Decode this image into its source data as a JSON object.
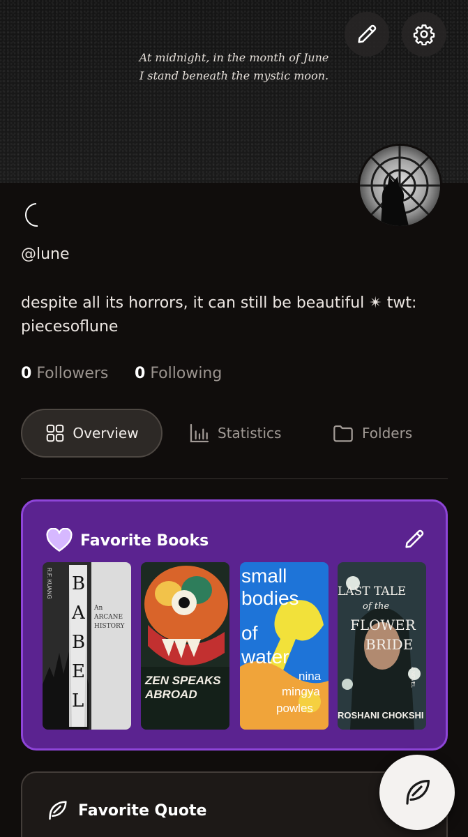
{
  "banner": {
    "quote_line1": "At midnight, in the month of June",
    "quote_line2": "I stand beneath the mystic moon."
  },
  "profile": {
    "display_name_icon": "crescent-moon-icon",
    "handle": "@lune",
    "bio": "despite all its horrors, it can still be beautiful ✴ twt: piecesoflune",
    "followers_count": "0",
    "followers_label": "Followers",
    "following_count": "0",
    "following_label": "Following"
  },
  "tabs": [
    {
      "label": "Overview",
      "icon": "grid-icon",
      "active": true
    },
    {
      "label": "Statistics",
      "icon": "bar-chart-icon",
      "active": false
    },
    {
      "label": "Folders",
      "icon": "folder-icon",
      "active": false
    }
  ],
  "favorite_books": {
    "title": "Favorite Books",
    "books": [
      {
        "cover_text": "BABEL",
        "author": "R.F. KUANG",
        "subtitle": "An ARCANE HISTORY"
      },
      {
        "cover_text": "ZEN SPEAKS ABROAD"
      },
      {
        "cover_text_1": "small",
        "cover_text_2": "bodies",
        "cover_text_3": "of",
        "cover_text_4": "water",
        "author_1": "nina",
        "author_2": "mingya",
        "author_3": "powles"
      },
      {
        "cover_text_1": "LAST TALE",
        "cover_text_2": "of the",
        "cover_text_3": "FLOWER",
        "cover_text_4": "BRIDE",
        "author": "ROSHANI CHOKSHI",
        "series": "A NOVEL"
      }
    ]
  },
  "favorite_quote": {
    "title": "Favorite Quote"
  },
  "colors": {
    "background": "#100d0c",
    "favorite_card": "#5b2390",
    "favorite_card_border": "#8e45d8",
    "accent_heart": "#d6b8ff"
  }
}
